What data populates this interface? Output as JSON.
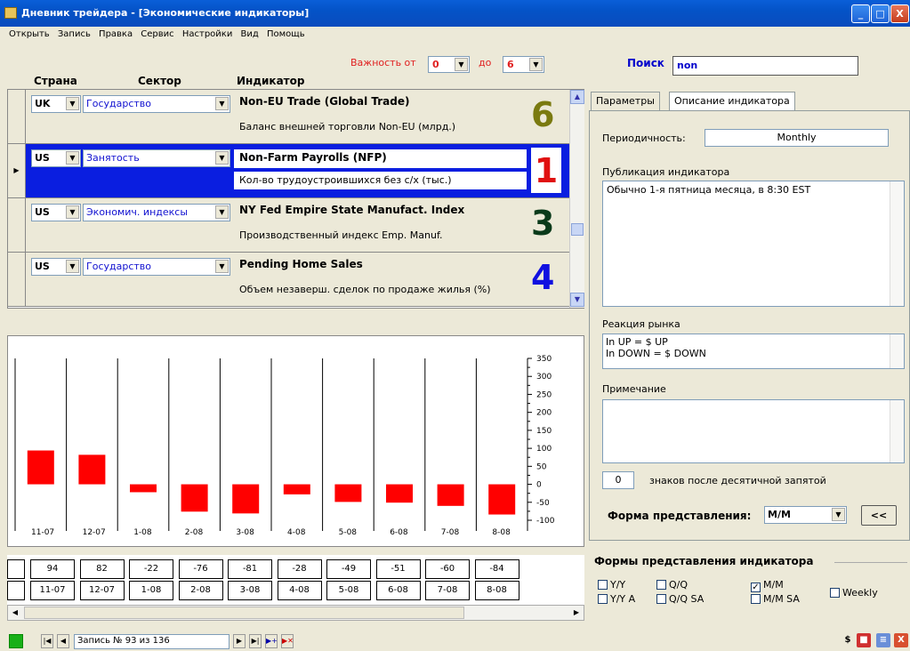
{
  "window": {
    "title": "Дневник трейдера - [Экономические индикаторы]",
    "buttons": [
      "_",
      "□",
      "X"
    ]
  },
  "menu": [
    "Открыть",
    "Запись",
    "Правка",
    "Сервис",
    "Настройки",
    "Вид",
    "Помощь"
  ],
  "header": {
    "country": "Страна",
    "sector": "Сектор",
    "indicator": "Индикатор",
    "importance_from_label": "Важность от",
    "importance_from": "0",
    "importance_to_label": "до",
    "importance_to": "6"
  },
  "search": {
    "label": "Поиск",
    "value": "non"
  },
  "rows": [
    {
      "country": "UK",
      "sector": "Государство",
      "name": "Non-EU Trade (Global Trade)",
      "desc": "Баланс внешней торговли Non-EU (млрд.)",
      "importance": "6",
      "color": "#7a7a10",
      "active": false
    },
    {
      "country": "US",
      "sector": "Занятость",
      "name": "Non-Farm Payrolls (NFP)",
      "desc": "Кол-во трудоустроившихся без с/х (тыс.)",
      "importance": "1",
      "color": "#e01010",
      "active": true
    },
    {
      "country": "US",
      "sector": "Экономич. индексы",
      "name": "NY Fed Empire State Manufact. Index",
      "desc": "Производственный индекс Emp. Manuf.",
      "importance": "3",
      "color": "#0a3a1a",
      "active": false
    },
    {
      "country": "US",
      "sector": "Государство",
      "name": "Pending Home Sales",
      "desc": "Объем незаверш. сделок по продаже жилья (%)",
      "importance": "4",
      "color": "#1010e0",
      "active": false
    }
  ],
  "chart_data": {
    "type": "bar",
    "categories": [
      "11-07",
      "12-07",
      "1-08",
      "2-08",
      "3-08",
      "4-08",
      "5-08",
      "6-08",
      "7-08",
      "8-08"
    ],
    "values": [
      94,
      82,
      -22,
      -76,
      -81,
      -28,
      -49,
      -51,
      -60,
      -84
    ],
    "yticks": [
      350,
      300,
      250,
      200,
      150,
      100,
      50,
      0,
      -50,
      -100
    ],
    "ylim": [
      -100,
      350
    ],
    "bar_color": "#ff0000"
  },
  "values_row": [
    "94",
    "82",
    "-22",
    "-76",
    "-81",
    "-28",
    "-49",
    "-51",
    "-60",
    "-84"
  ],
  "periods_row": [
    "11-07",
    "12-07",
    "1-08",
    "2-08",
    "3-08",
    "4-08",
    "5-08",
    "6-08",
    "7-08",
    "8-08"
  ],
  "navigator": {
    "record": "Запись № 93 из 136"
  },
  "tabs": [
    "Параметры",
    "Описание индикатора"
  ],
  "params": {
    "periodicity_label": "Периодичность:",
    "periodicity": "Monthly",
    "publication_label": "Публикация индикатора",
    "publication": "Обычно 1-я пятница месяца, в 8:30 EST",
    "reaction_label": "Реакция рынка",
    "reaction_line1": "In UP = $ UP",
    "reaction_line2": "In DOWN = $ DOWN",
    "note_label": "Примечание",
    "note": "",
    "decimals": "0",
    "decimals_label": "знаков после десятичной запятой",
    "form_label": "Форма представления:",
    "form_value": "M/M",
    "back_button": "<<"
  },
  "forms": {
    "title": "Формы представления индикатора",
    "items": [
      {
        "label": "Y/Y",
        "checked": false
      },
      {
        "label": "Q/Q",
        "checked": false
      },
      {
        "label": "M/M",
        "checked": true
      },
      {
        "label": "Y/Y A",
        "checked": false
      },
      {
        "label": "Q/Q SA",
        "checked": false
      },
      {
        "label": "M/M SA",
        "checked": false
      },
      {
        "label": "Weekly",
        "checked": false
      }
    ]
  }
}
